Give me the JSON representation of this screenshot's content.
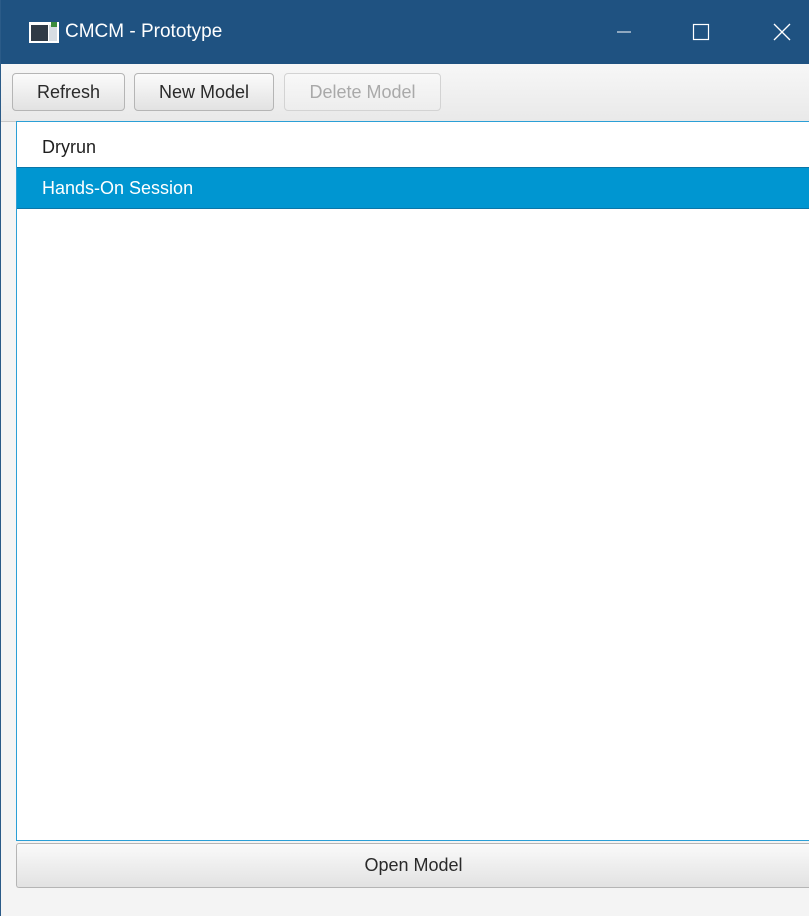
{
  "window": {
    "title": "CMCM - Prototype",
    "app_icon": "app-window-icon",
    "caption_buttons": {
      "minimize_icon": "minimize-icon",
      "maximize_icon": "maximize-icon",
      "close_icon": "close-icon"
    },
    "colors": {
      "titlebar": "#1f5281",
      "selection": "#0096d1",
      "focus_border": "#2b9fd6"
    }
  },
  "toolbar": {
    "refresh_label": "Refresh",
    "new_model_label": "New Model",
    "delete_model_label": "Delete Model"
  },
  "models": {
    "items": [
      {
        "label": "Dryrun",
        "selected": false
      },
      {
        "label": "Hands-On Session",
        "selected": true
      }
    ]
  },
  "footer": {
    "open_model_label": "Open Model"
  }
}
